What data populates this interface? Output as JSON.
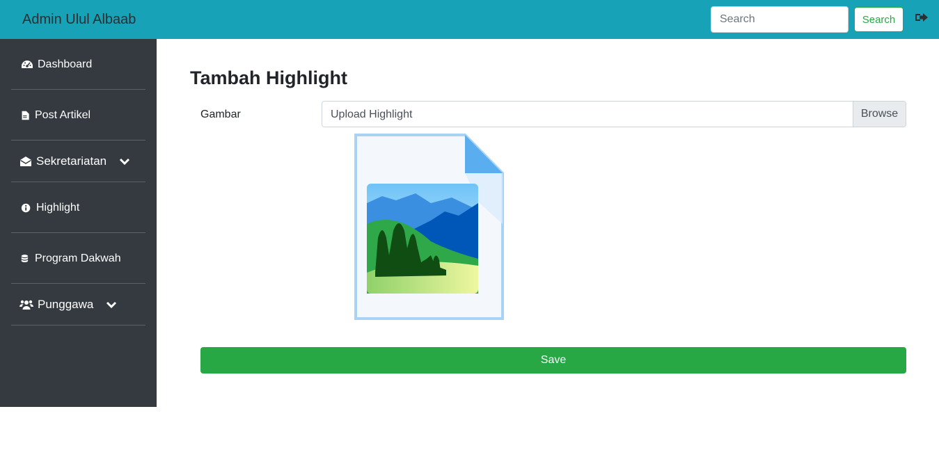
{
  "header": {
    "brand": "Admin Ulul Albaab",
    "search_placeholder": "Search",
    "search_button": "Search",
    "logout_icon": "sign-out-icon"
  },
  "sidebar": {
    "items": [
      {
        "label": "Dashboard",
        "icon": "tachometer-icon"
      },
      {
        "label": "Post Artikel",
        "icon": "file-icon"
      },
      {
        "label": "Sekretariatan",
        "icon": "envelope-open-icon",
        "dropdown": true
      },
      {
        "label": "Highlight",
        "icon": "info-circle-icon"
      },
      {
        "label": "Program Dakwah",
        "icon": "database-icon"
      },
      {
        "label": "Punggawa",
        "icon": "users-icon",
        "dropdown": true
      }
    ]
  },
  "main": {
    "title": "Tambah Highlight",
    "field_label": "Gambar",
    "file_placeholder": "Upload Highlight",
    "browse_label": "Browse",
    "preview_icon": "image-file-icon",
    "save_label": "Save"
  },
  "colors": {
    "topbar": "#17a2b8",
    "sidebar": "#343a40",
    "save_button": "#28a745"
  }
}
